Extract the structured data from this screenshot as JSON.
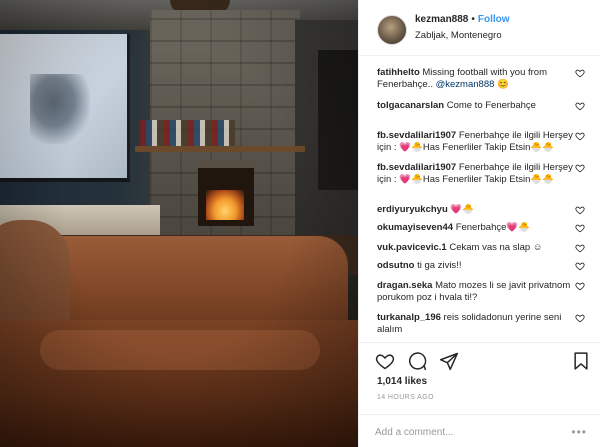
{
  "post": {
    "username": "kezman888",
    "separator": "•",
    "follow_label": "Follow",
    "location": "Zabljak, Montenegro",
    "likes": "1,014 likes",
    "time": "14 HOURS AGO",
    "add_comment_placeholder": "Add a comment...",
    "more_label": "•••"
  },
  "icons": {
    "heart": "heart-outline-icon",
    "comment": "comment-bubble-icon",
    "share": "share-arrow-icon",
    "bookmark": "bookmark-icon"
  },
  "comments": [
    {
      "user": "fatihhelto",
      "text": "Missing football with you from Fenerbahçe.. ",
      "mention": "@kezman888",
      "suffix": " 😊"
    },
    {
      "user": "tolgacanarslan",
      "text": "Come to Fenerbahçe",
      "mention": "",
      "suffix": ""
    },
    {
      "user": "fb.sevdalilari1907",
      "text": "Fenerbahçe ile ilgili Herşey için : 💗🐣Has Fenerliler Takip Etsin🐣🐣",
      "mention": "",
      "suffix": ""
    },
    {
      "user": "fb.sevdalilari1907",
      "text": "Fenerbahçe ile ilgili Herşey için : 💗🐣Has Fenerliler Takip Etsin🐣🐣",
      "mention": "",
      "suffix": ""
    },
    {
      "user": "erdiyuryukchyu",
      "text": "💗🐣",
      "mention": "",
      "suffix": ""
    },
    {
      "user": "okumayiseven44",
      "text": "Fenerbahçe💗🐣",
      "mention": "",
      "suffix": ""
    },
    {
      "user": "vuk.pavicevic.1",
      "text": "Cekam vas na slap ☺",
      "mention": "",
      "suffix": ""
    },
    {
      "user": "odsutno",
      "text": "ti ga zivis!!",
      "mention": "",
      "suffix": ""
    },
    {
      "user": "dragan.seka",
      "text": "Mato mozes li se javit privatnom porukom poz i hvala ti!?",
      "mention": "",
      "suffix": ""
    },
    {
      "user": "turkanalp_196",
      "text": "reis solidadonun yerine seni alalım",
      "mention": "",
      "suffix": ""
    }
  ]
}
